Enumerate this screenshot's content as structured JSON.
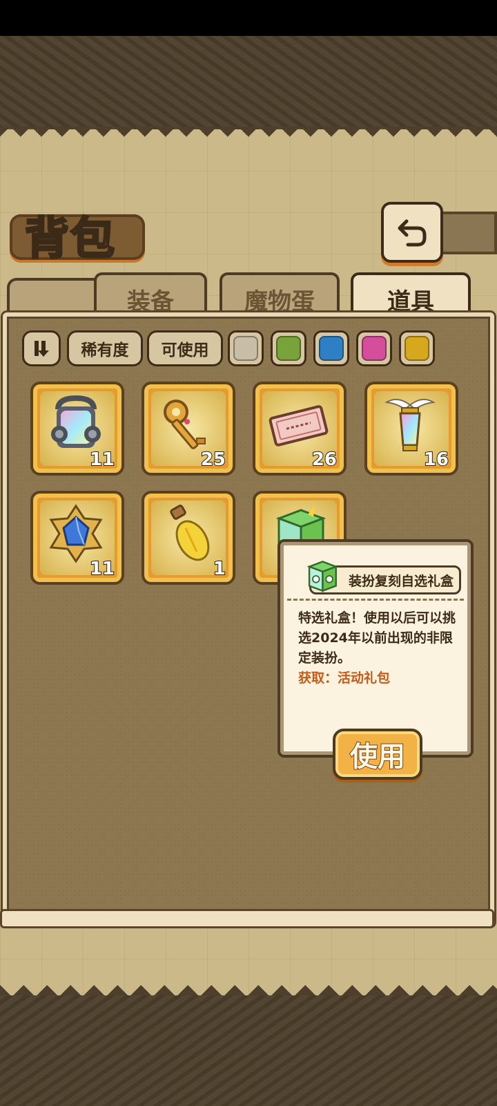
{
  "header": {
    "title": "背包"
  },
  "tabs": [
    {
      "label": "装备",
      "active": false
    },
    {
      "label": "魔物蛋",
      "active": false
    },
    {
      "label": "道具",
      "active": true
    }
  ],
  "filters": {
    "sort_icon": "sort-toggle-icon",
    "rarity_label": "稀有度",
    "usable_label": "可使用",
    "color_chips": [
      "#c8bda5",
      "#7aa23a",
      "#2f7fc4",
      "#d44e9c",
      "#d6a81e"
    ]
  },
  "items": [
    {
      "icon": "rainbow-backpack-icon",
      "count": "11"
    },
    {
      "icon": "golden-key-icon",
      "count": "25"
    },
    {
      "icon": "ticket-icon",
      "count": "26"
    },
    {
      "icon": "winged-lantern-icon",
      "count": "16"
    },
    {
      "icon": "blue-gem-badge-icon",
      "count": "11"
    },
    {
      "icon": "yellow-potion-icon",
      "count": "1"
    },
    {
      "icon": "gift-box-icon",
      "count": ""
    }
  ],
  "popup": {
    "name": "装扮复刻自选礼盒",
    "description": "特选礼盒！使用以后可以挑选2024年以前出现的非限定装扮。",
    "source": "获取：活动礼包",
    "use_label": "使用"
  }
}
